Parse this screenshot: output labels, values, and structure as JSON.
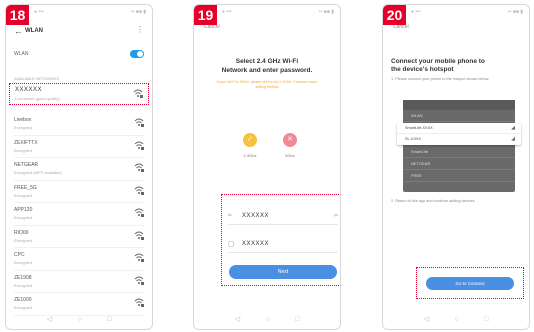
{
  "steps": [
    {
      "number": "18",
      "status_left": "● •••",
      "status_right": "•• ■■ ▮",
      "header": {
        "back_icon": "arrow-left-icon",
        "title": "WLAN",
        "more_icon": "more-vertical-icon"
      },
      "toggle_label": "WLAN",
      "section_label": "AVAILABLE NETWORKS",
      "networks": [
        {
          "name": "XXXXXX",
          "sub": "Connected (good quality)",
          "selected": true
        },
        {
          "name": "Livebox",
          "sub": "Encrypted"
        },
        {
          "name": "ZEXIFTTX",
          "sub": "Encrypted"
        },
        {
          "name": "NETGEAR",
          "sub": "Encrypted (WPS available)"
        },
        {
          "name": "FREE_5G",
          "sub": "Encrypted"
        },
        {
          "name": "APP120",
          "sub": "Encrypted"
        },
        {
          "name": "RIO00",
          "sub": "Encrypted"
        },
        {
          "name": "CPC",
          "sub": "Encrypted"
        },
        {
          "name": "ZE1908",
          "sub": "Encrypted"
        },
        {
          "name": "ZE1000",
          "sub": "Encrypted"
        }
      ],
      "nav": [
        "◁",
        "○",
        "□"
      ]
    },
    {
      "number": "19",
      "status_left": "● •••",
      "status_right": "•• ■■ ▮",
      "cancel": "Cancel",
      "title_line1": "Select 2.4 GHz Wi-Fi",
      "title_line2": "Network and enter password.",
      "note": "If your Wi-Fi is 5GHz, please set it to be 2.4GHz. Common router setting method",
      "bands": [
        {
          "icon": "✓",
          "label": "2.4Ghz"
        },
        {
          "icon": "✕",
          "label": "5Ghz"
        }
      ],
      "ssid_value": "XXXXXX",
      "password_value": "XXXXXX",
      "field_extra": "⇄",
      "next_label": "Next",
      "nav": [
        "◁",
        "○",
        "□"
      ]
    },
    {
      "number": "20",
      "status_left": "● •••",
      "status_right": "•• ■■ ▮",
      "cancel": "Cancel",
      "title_line1": "Connect your mobile phone to",
      "title_line2": "the device's hotspot",
      "step1": "1. Please connect your phone to the hotspot shown below.",
      "hotspot_rows": [
        "WLAN",
        "Smart",
        "SmartLife",
        "NETGEAR",
        "FREE"
      ],
      "hotspot_entries": [
        {
          "name": "SmartLife-XXXX",
          "icon": "◢"
        },
        {
          "name": "SL-XXXX",
          "icon": "◢"
        }
      ],
      "step2": "2. Return to this app and continue adding devices.",
      "connect_label": "Go to Connect",
      "nav": [
        "◁",
        "○",
        "□"
      ]
    }
  ],
  "colors": {
    "accent_red": "#e4002b",
    "button_blue": "#4a90e2",
    "toggle_blue": "#1e9be9"
  }
}
